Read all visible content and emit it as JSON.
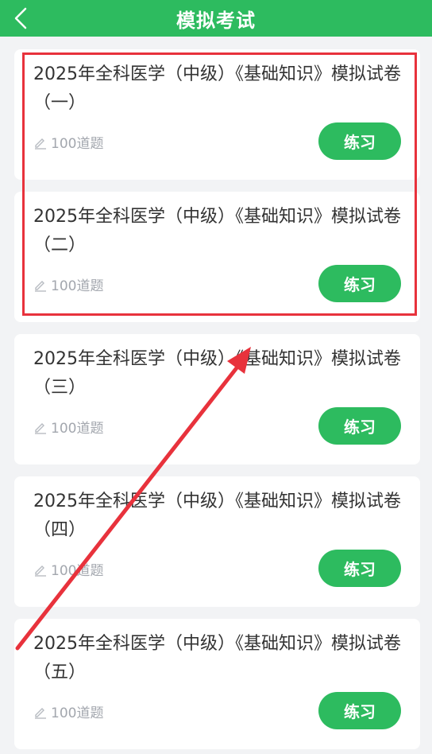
{
  "header": {
    "title": "模拟考试"
  },
  "exams": [
    {
      "title": "2025年全科医学（中级）《基础知识》模拟试卷（一）",
      "count": "100道题",
      "button": "练习"
    },
    {
      "title": "2025年全科医学（中级）《基础知识》模拟试卷（二）",
      "count": "100道题",
      "button": "练习"
    },
    {
      "title": "2025年全科医学（中级）《基础知识》模拟试卷（三）",
      "count": "100道题",
      "button": "练习"
    },
    {
      "title": "2025年全科医学（中级）《基础知识》模拟试卷（四）",
      "count": "100道题",
      "button": "练习"
    },
    {
      "title": "2025年全科医学（中级）《基础知识》模拟试卷（五）",
      "count": "100道题",
      "button": "练习"
    }
  ],
  "colors": {
    "brand": "#2dbb5f",
    "annotation": "#e8323c"
  },
  "icons": {
    "back": "chevron-left-icon",
    "count": "pencil-icon"
  }
}
